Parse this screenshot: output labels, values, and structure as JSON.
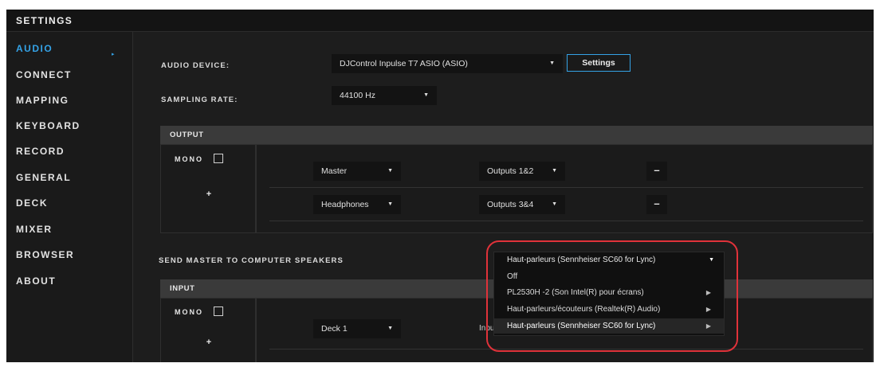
{
  "title": "SETTINGS",
  "sidebar": {
    "items": [
      {
        "label": "AUDIO",
        "active": true
      },
      {
        "label": "CONNECT"
      },
      {
        "label": "MAPPING"
      },
      {
        "label": "KEYBOARD"
      },
      {
        "label": "RECORD"
      },
      {
        "label": "GENERAL"
      },
      {
        "label": "DECK"
      },
      {
        "label": "MIXER"
      },
      {
        "label": "BROWSER"
      },
      {
        "label": "ABOUT"
      }
    ],
    "active_arrow": "▸"
  },
  "audio_device": {
    "label": "AUDIO DEVICE:",
    "value": "DJControl Inpulse T7 ASIO (ASIO)",
    "settings_button": "Settings"
  },
  "sampling_rate": {
    "label": "SAMPLING RATE:",
    "value": "44100 Hz"
  },
  "output": {
    "header": "OUTPUT",
    "mono_label": "MONO",
    "mono_checked": false,
    "add_button": "+",
    "rows": [
      {
        "channel": "Master",
        "outputs": "Outputs 1&2",
        "remove": "–"
      },
      {
        "channel": "Headphones",
        "outputs": "Outputs 3&4",
        "remove": "–"
      }
    ]
  },
  "send_master": {
    "label": "SEND MASTER TO COMPUTER SPEAKERS",
    "selected": "Haut-parleurs (Sennheiser SC60 for Lync)",
    "options": [
      {
        "label": "Off",
        "submenu": false
      },
      {
        "label": "PL2530H -2 (Son Intel(R) pour écrans)",
        "submenu": true
      },
      {
        "label": "Haut-parleurs/écouteurs (Realtek(R) Audio)",
        "submenu": true
      },
      {
        "label": "Haut-parleurs (Sennheiser SC60 for Lync)",
        "submenu": true,
        "selected": true
      }
    ]
  },
  "input": {
    "header": "INPUT",
    "mono_label": "MONO",
    "mono_checked": false,
    "add_button": "+",
    "rows": [
      {
        "channel": "Deck 1",
        "partial_text": "Inpu"
      }
    ]
  },
  "icons": {
    "caret": "▼",
    "submenu_arrow": "▶"
  },
  "colors": {
    "accent": "#34a2e6",
    "highlight": "#e0323a",
    "background": "#1d1d1d"
  }
}
